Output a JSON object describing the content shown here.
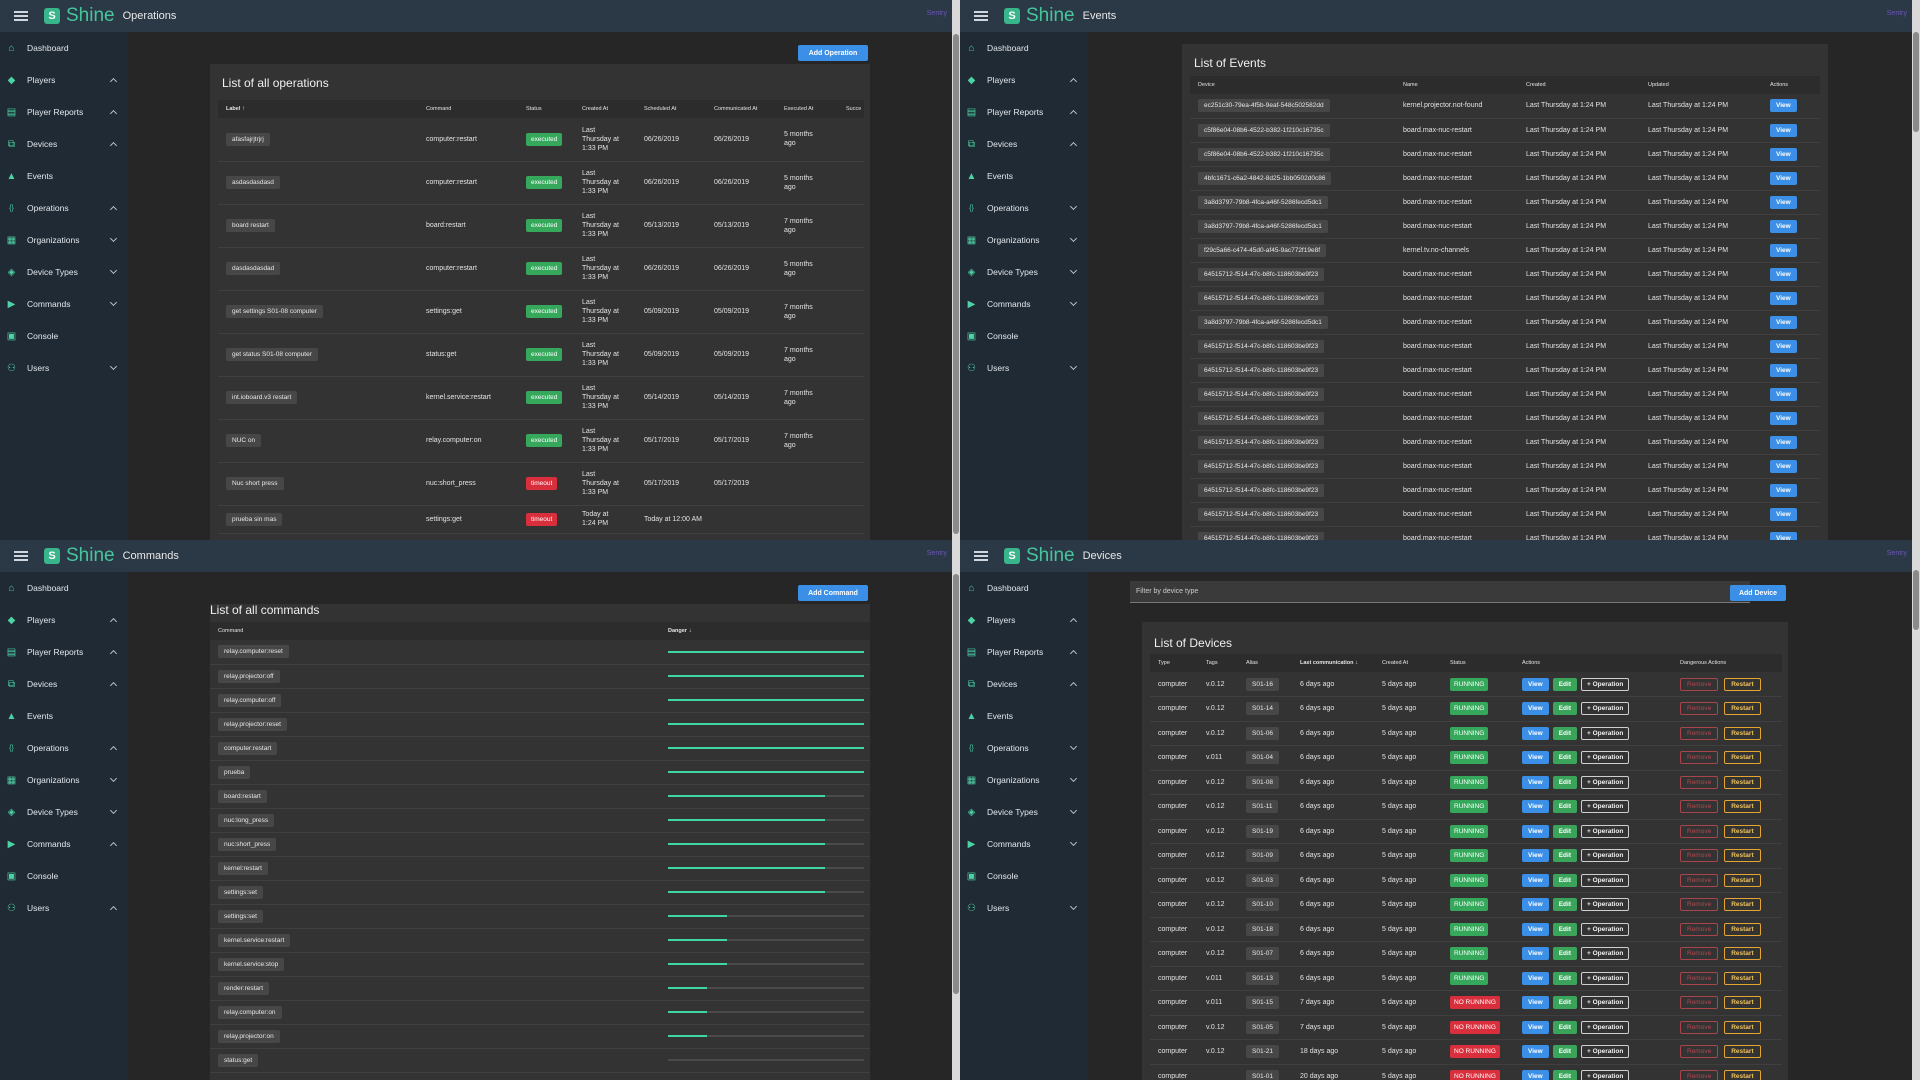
{
  "brand": "Shine",
  "sentry_label": "Sentry",
  "sidebar": [
    {
      "label": "Dashboard",
      "icon": "home-icon"
    },
    {
      "label": "Players",
      "icon": "cube-icon"
    },
    {
      "label": "Player Reports",
      "icon": "report-icon"
    },
    {
      "label": "Devices",
      "icon": "chart-icon"
    },
    {
      "label": "Events",
      "icon": "warning-icon"
    },
    {
      "label": "Operations",
      "icon": "code-icon"
    },
    {
      "label": "Organizations",
      "icon": "building-icon"
    },
    {
      "label": "Device Types",
      "icon": "layers-icon"
    },
    {
      "label": "Commands",
      "icon": "play-icon"
    },
    {
      "label": "Console",
      "icon": "terminal-icon"
    },
    {
      "label": "Users",
      "icon": "users-icon"
    }
  ],
  "sidebar_chevrons": {
    "operations": [
      "",
      "up",
      "up",
      "up",
      "",
      "up",
      "down",
      "down",
      "down",
      "",
      "down"
    ],
    "events": [
      "",
      "up",
      "up",
      "up",
      "",
      "down",
      "down",
      "down",
      "down",
      "",
      "down"
    ],
    "commands": [
      "",
      "up",
      "up",
      "up",
      "",
      "up",
      "down",
      "down",
      "up",
      "",
      "up"
    ],
    "devices": [
      "",
      "up",
      "up",
      "up",
      "",
      "down",
      "down",
      "down",
      "down",
      "",
      "down"
    ]
  },
  "operations": {
    "page_title": "Operations",
    "card_title": "List of all operations",
    "add_button": "Add Operation",
    "columns": [
      "Label",
      "Command",
      "Status",
      "Created At",
      "Scheduled At",
      "Communicated At",
      "Executed At",
      "Succe"
    ],
    "rows": [
      {
        "label": "afasfajrjtrjrj",
        "command": "computer:restart",
        "status": "executed",
        "created": "Last Thursday at 1:33 PM",
        "scheduled": "06/26/2019",
        "communicated": "06/26/2019",
        "executed": "5 months ago"
      },
      {
        "label": "asdasdasdasd",
        "command": "computer:restart",
        "status": "executed",
        "created": "Last Thursday at 1:33 PM",
        "scheduled": "06/26/2019",
        "communicated": "06/26/2019",
        "executed": "5 months ago"
      },
      {
        "label": "board restart",
        "command": "board:restart",
        "status": "executed",
        "created": "Last Thursday at 1:33 PM",
        "scheduled": "05/13/2019",
        "communicated": "05/13/2019",
        "executed": "7 months ago"
      },
      {
        "label": "dasdasdasdad",
        "command": "computer:restart",
        "status": "executed",
        "created": "Last Thursday at 1:33 PM",
        "scheduled": "06/26/2019",
        "communicated": "06/26/2019",
        "executed": "5 months ago"
      },
      {
        "label": "get settings S01-08 computer",
        "command": "settings:get",
        "status": "executed",
        "created": "Last Thursday at 1:33 PM",
        "scheduled": "05/09/2019",
        "communicated": "05/09/2019",
        "executed": "7 months ago"
      },
      {
        "label": "get status S01-08 computer",
        "command": "status:get",
        "status": "executed",
        "created": "Last Thursday at 1:33 PM",
        "scheduled": "05/09/2019",
        "communicated": "05/09/2019",
        "executed": "7 months ago"
      },
      {
        "label": "int.ioboard.v3 restart",
        "command": "kernel.service:restart",
        "status": "executed",
        "created": "Last Thursday at 1:33 PM",
        "scheduled": "05/14/2019",
        "communicated": "05/14/2019",
        "executed": "7 months ago"
      },
      {
        "label": "NUC on",
        "command": "relay.computer:on",
        "status": "executed",
        "created": "Last Thursday at 1:33 PM",
        "scheduled": "05/17/2019",
        "communicated": "05/17/2019",
        "executed": "7 months ago"
      },
      {
        "label": "Nuc short press",
        "command": "nuc:short_press",
        "status": "timeout",
        "created": "Last Thursday at 1:33 PM",
        "scheduled": "05/17/2019",
        "communicated": "05/17/2019",
        "executed": ""
      },
      {
        "label": "prueba sin mas",
        "command": "settings:get",
        "status": "timeout",
        "created": "Today at 1:24 PM",
        "scheduled": "Today at 12:00 AM",
        "communicated": "",
        "executed": ""
      }
    ]
  },
  "events": {
    "page_title": "Events",
    "card_title": "List of Events",
    "columns": [
      "Device",
      "Name",
      "Created",
      "Updated",
      "Actions"
    ],
    "view_label": "View",
    "rows": [
      {
        "device": "ec251c30-79ea-4f5b-9eaf-548c502582dd",
        "name": "kernel.projector.not-found"
      },
      {
        "device": "c5f86e04-08b6-4522-b382-1f210c16735c",
        "name": "board.max-nuc-restart"
      },
      {
        "device": "c5f86e04-08b6-4522-b382-1f210c16735c",
        "name": "board.max-nuc-restart"
      },
      {
        "device": "4bfc1671-c6a2-4842-8d25-1bb0502d0c86",
        "name": "board.max-nuc-restart"
      },
      {
        "device": "3a8d3797-79b8-4fca-a46f-5286fecd5dc1",
        "name": "board.max-nuc-restart"
      },
      {
        "device": "3a8d3797-79b8-4fca-a46f-5286fecd5dc1",
        "name": "board.max-nuc-restart"
      },
      {
        "device": "f29c5a66-c474-45d0-af45-9ac772f19e8f",
        "name": "kernel.tv.no-channels"
      },
      {
        "device": "64515712-f514-47c-b8fc-118603be9f23",
        "name": "board.max-nuc-restart"
      },
      {
        "device": "64515712-f514-47c-b8fc-118603be9f23",
        "name": "board.max-nuc-restart"
      },
      {
        "device": "3a8d3797-79b8-4fca-a46f-5286fecd5dc1",
        "name": "board.max-nuc-restart"
      },
      {
        "device": "64515712-f514-47c-b8fc-118603be9f23",
        "name": "board.max-nuc-restart"
      },
      {
        "device": "64515712-f514-47c-b8fc-118603be9f23",
        "name": "board.max-nuc-restart"
      },
      {
        "device": "64515712-f514-47c-b8fc-118603be9f23",
        "name": "board.max-nuc-restart"
      },
      {
        "device": "64515712-f514-47c-b8fc-118603be9f23",
        "name": "board.max-nuc-restart"
      },
      {
        "device": "64515712-f514-47c-b8fc-118603be9f23",
        "name": "board.max-nuc-restart"
      },
      {
        "device": "64515712-f514-47c-b8fc-118603be9f23",
        "name": "board.max-nuc-restart"
      },
      {
        "device": "64515712-f514-47c-b8fc-118603be9f23",
        "name": "board.max-nuc-restart"
      },
      {
        "device": "64515712-f514-47c-b8fc-118603be9f23",
        "name": "board.max-nuc-restart"
      },
      {
        "device": "64515712-f514-47c-b8fc-118603be9f23",
        "name": "board.max-nuc-restart"
      }
    ],
    "created": "Last Thursday at 1:24 PM",
    "updated": "Last Thursday at 1:24 PM"
  },
  "commands": {
    "page_title": "Commands",
    "card_title": "List of all commands",
    "add_button": "Add Command",
    "columns": [
      "Command",
      "Danger"
    ],
    "rows": [
      {
        "command": "relay.computer:reset",
        "danger": 1.0
      },
      {
        "command": "relay.projector:off",
        "danger": 1.0
      },
      {
        "command": "relay.computer:off",
        "danger": 1.0
      },
      {
        "command": "relay.projector:reset",
        "danger": 1.0
      },
      {
        "command": "computer:restart",
        "danger": 1.0
      },
      {
        "command": "prueba",
        "danger": 1.0
      },
      {
        "command": "board:restart",
        "danger": 0.8
      },
      {
        "command": "nuc:long_press",
        "danger": 0.8
      },
      {
        "command": "nuc:short_press",
        "danger": 0.8
      },
      {
        "command": "kernel:restart",
        "danger": 0.8
      },
      {
        "command": "settings:set",
        "danger": 0.8
      },
      {
        "command": "settings:set",
        "danger": 0.3
      },
      {
        "command": "kernel.service:restart",
        "danger": 0.3
      },
      {
        "command": "kernel.service:stop",
        "danger": 0.3
      },
      {
        "command": "render:restart",
        "danger": 0.2
      },
      {
        "command": "relay.computer:on",
        "danger": 0.2
      },
      {
        "command": "relay.projector:on",
        "danger": 0.2
      },
      {
        "command": "status:get",
        "danger": 0.0
      }
    ]
  },
  "devices": {
    "page_title": "Devices",
    "card_title": "List of Devices",
    "add_button": "Add Device",
    "filter_placeholder": "Filter by device type",
    "columns": [
      "Type",
      "Tags",
      "Alias",
      "Last communication",
      "Created At",
      "Status",
      "Actions",
      "Dangerous Actions"
    ],
    "buttons": {
      "view": "View",
      "edit": "Edit",
      "operation": "+ Operation",
      "remove": "Remove",
      "restart": "Restart"
    },
    "rows": [
      {
        "type": "computer",
        "tags": "v.0.12",
        "alias": "S01-16",
        "last": "6 days ago",
        "created": "5 days ago",
        "status": "RUNNING"
      },
      {
        "type": "computer",
        "tags": "v.0.12",
        "alias": "S01-14",
        "last": "6 days ago",
        "created": "5 days ago",
        "status": "RUNNING"
      },
      {
        "type": "computer",
        "tags": "v.0.12",
        "alias": "S01-06",
        "last": "6 days ago",
        "created": "5 days ago",
        "status": "RUNNING"
      },
      {
        "type": "computer",
        "tags": "v.011",
        "alias": "S01-04",
        "last": "6 days ago",
        "created": "5 days ago",
        "status": "RUNNING"
      },
      {
        "type": "computer",
        "tags": "v.0.12",
        "alias": "S01-08",
        "last": "6 days ago",
        "created": "5 days ago",
        "status": "RUNNING"
      },
      {
        "type": "computer",
        "tags": "v.0.12",
        "alias": "S01-11",
        "last": "6 days ago",
        "created": "5 days ago",
        "status": "RUNNING"
      },
      {
        "type": "computer",
        "tags": "v.0.12",
        "alias": "S01-19",
        "last": "6 days ago",
        "created": "5 days ago",
        "status": "RUNNING"
      },
      {
        "type": "computer",
        "tags": "v.0.12",
        "alias": "S01-09",
        "last": "6 days ago",
        "created": "5 days ago",
        "status": "RUNNING"
      },
      {
        "type": "computer",
        "tags": "v.0.12",
        "alias": "S01-03",
        "last": "6 days ago",
        "created": "5 days ago",
        "status": "RUNNING"
      },
      {
        "type": "computer",
        "tags": "v.0.12",
        "alias": "S01-10",
        "last": "6 days ago",
        "created": "5 days ago",
        "status": "RUNNING"
      },
      {
        "type": "computer",
        "tags": "v.0.12",
        "alias": "S01-18",
        "last": "6 days ago",
        "created": "5 days ago",
        "status": "RUNNING"
      },
      {
        "type": "computer",
        "tags": "v.0.12",
        "alias": "S01-07",
        "last": "6 days ago",
        "created": "5 days ago",
        "status": "RUNNING"
      },
      {
        "type": "computer",
        "tags": "v.011",
        "alias": "S01-13",
        "last": "6 days ago",
        "created": "5 days ago",
        "status": "RUNNING"
      },
      {
        "type": "computer",
        "tags": "v.011",
        "alias": "S01-15",
        "last": "7 days ago",
        "created": "5 days ago",
        "status": "NO RUNNING"
      },
      {
        "type": "computer",
        "tags": "v.0.12",
        "alias": "S01-05",
        "last": "7 days ago",
        "created": "5 days ago",
        "status": "NO RUNNING"
      },
      {
        "type": "computer",
        "tags": "v.0.12",
        "alias": "S01-21",
        "last": "18 days ago",
        "created": "5 days ago",
        "status": "NO RUNNING"
      },
      {
        "type": "computer",
        "tags": "",
        "alias": "S01-01",
        "last": "20 days ago",
        "created": "5 days ago",
        "status": "NO RUNNING"
      }
    ]
  }
}
